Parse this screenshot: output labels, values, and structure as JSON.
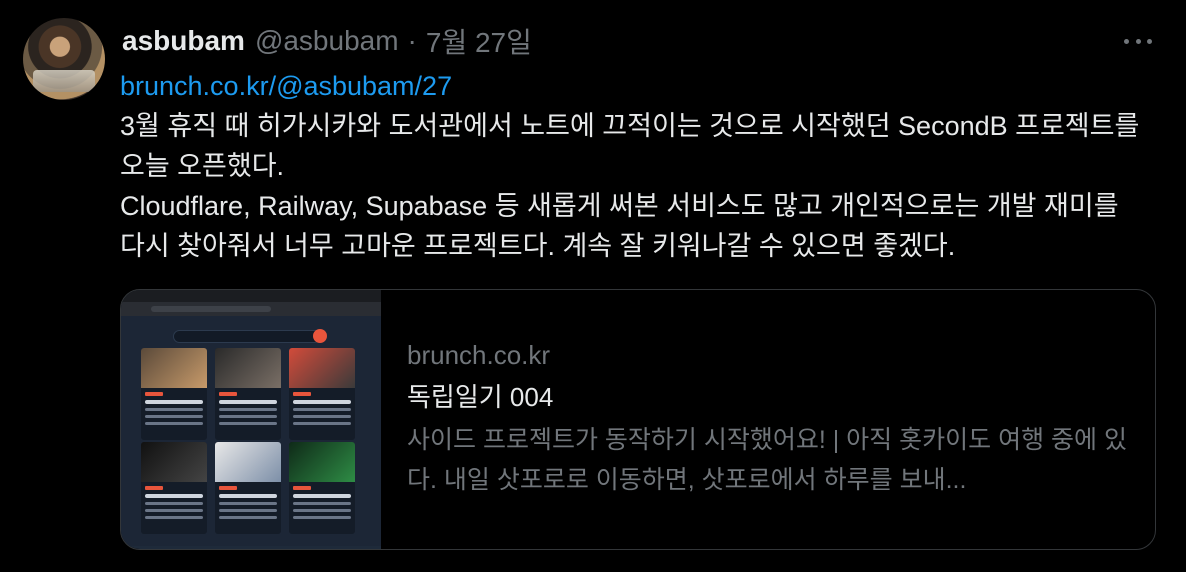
{
  "tweet": {
    "author_name": "asbubam",
    "author_handle": "@asbubam",
    "separator": "·",
    "date": "7월 27일",
    "link_text": "brunch.co.kr/@asbubam/27",
    "paragraph_1": "3월 휴직 때 히가시카와 도서관에서 노트에 끄적이는 것으로 시작했던 SecondB 프로젝트를 오늘 오픈했다.",
    "paragraph_2": "Cloudflare, Railway, Supabase 등 새롭게 써본 서비스도 많고 개인적으로는 개발 재미를 다시 찾아줘서 너무 고마운 프로젝트다. 계속 잘 키워나갈 수 있으면 좋겠다."
  },
  "card": {
    "domain": "brunch.co.kr",
    "title": "독립일기 004",
    "description": "사이드 프로젝트가 동작하기 시작했어요! | 아직 홋카이도 여행 중에 있다. 내일 삿포로로 이동하면, 삿포로에서 하루를 보내..."
  },
  "colors": {
    "background": "#000000",
    "link": "#1d9bf0",
    "text_primary": "#e7e9ea",
    "text_secondary": "#71767b",
    "border": "#333639"
  },
  "icons": {
    "more": "more-horizontal-icon"
  }
}
